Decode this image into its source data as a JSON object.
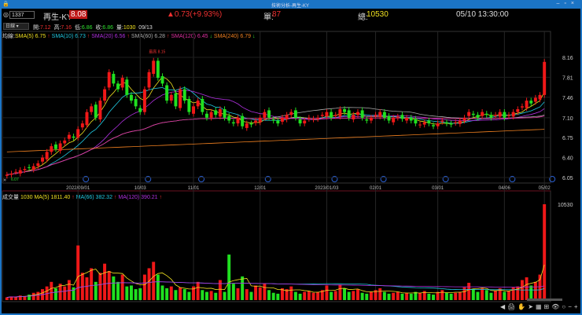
{
  "window": {
    "title": "技術分析-再生-KY"
  },
  "quote": {
    "code": "1337",
    "name": "再生-KY",
    "price": "8.08",
    "change": "▲0.73(+9.93%)",
    "unit_label": "單:",
    "unit": "87",
    "total_label": "總:",
    "total": "10530",
    "datetime": "05/10 13:30:00"
  },
  "ohlc": {
    "period": "日線",
    "open_label": "開:",
    "open": "7.12",
    "high_label": "高:",
    "high": "7.16",
    "low_label": "低:",
    "low": "6.86",
    "close_label": "收:",
    "close": "6.86",
    "vol_label": "量:",
    "vol": "1030",
    "date": "09/13"
  },
  "ma": {
    "label": "均線:",
    "items": [
      {
        "t": "SMA(5) 6.75",
        "c": "#f0e020",
        "a": "↑",
        "ac": "#f03030"
      },
      {
        "t": "SMA(10) 6.73",
        "c": "#20c8e0",
        "a": "↑",
        "ac": "#f03030"
      },
      {
        "t": "SMA(20) 6.56",
        "c": "#b030e0",
        "a": "↑",
        "ac": "#f03030"
      },
      {
        "t": "SMA(60) 6.28",
        "c": "#aaaaaa",
        "a": "↑",
        "ac": "#f03030"
      },
      {
        "t": "SMA(120) 6.45",
        "c": "#e030a0",
        "a": "↓",
        "ac": "#30e030"
      },
      {
        "t": "SMA(240) 6.79",
        "c": "#f08020",
        "a": "↓",
        "ac": "#30e030"
      }
    ]
  },
  "vol_ma": {
    "label": "成交量",
    "value": "1030",
    "items": [
      {
        "t": "MA(5) 1811.40",
        "c": "#f0e020"
      },
      {
        "t": "MA(66) 382.32",
        "c": "#20c8e0"
      },
      {
        "t": "MA(120) 390.21",
        "c": "#b030e0"
      }
    ],
    "arrow": "↑"
  },
  "annotations": {
    "high_mark": "最高 8.15",
    "low_mark": "6.07"
  },
  "chart_data": {
    "type": "candlestick",
    "price_ticks": [
      "8.16",
      "7.81",
      "7.46",
      "7.10",
      "6.75",
      "6.40",
      "6.05"
    ],
    "price_range": [
      6.05,
      8.16
    ],
    "volume_tick": "10530",
    "volume_max": 10530,
    "x_labels": [
      {
        "t": "2022/09/01",
        "i": 16
      },
      {
        "t": "10/03",
        "i": 30
      },
      {
        "t": "11/01",
        "i": 42
      },
      {
        "t": "12/01",
        "i": 57
      },
      {
        "t": "2023/01/03",
        "i": 72
      },
      {
        "t": "02/01",
        "i": 83
      },
      {
        "t": "03/01",
        "i": 97
      },
      {
        "t": "04/06",
        "i": 112
      },
      {
        "t": "05/02",
        "i": 121
      }
    ],
    "closes": [
      6.1,
      6.12,
      6.15,
      6.18,
      6.2,
      6.22,
      6.25,
      6.3,
      6.4,
      6.5,
      6.6,
      6.55,
      6.65,
      6.7,
      6.8,
      6.75,
      6.9,
      7.0,
      7.2,
      7.3,
      7.1,
      7.4,
      7.6,
      7.9,
      7.7,
      7.6,
      7.8,
      7.5,
      7.4,
      7.3,
      7.2,
      7.6,
      7.9,
      8.1,
      7.8,
      7.7,
      7.4,
      7.5,
      7.3,
      7.6,
      7.4,
      7.2,
      7.3,
      7.4,
      7.2,
      7.1,
      7.2,
      7.15,
      7.25,
      7.1,
      7.05,
      7.0,
      7.1,
      6.95,
      7.0,
      6.98,
      7.05,
      7.1,
      7.2,
      7.1,
      7.05,
      7.0,
      7.1,
      7.15,
      7.2,
      7.1,
      7.0,
      7.05,
      7.1,
      7.08,
      7.1,
      7.15,
      7.2,
      7.1,
      7.15,
      7.25,
      7.2,
      7.1,
      7.15,
      7.2,
      7.1,
      7.05,
      7.1,
      7.15,
      7.2,
      7.1,
      7.05,
      7.1,
      7.12,
      7.08,
      7.1,
      7.05,
      7.0,
      6.98,
      7.02,
      7.0,
      6.95,
      7.0,
      7.05,
      7.0,
      6.98,
      7.02,
      7.05,
      7.1,
      7.2,
      7.15,
      7.1,
      7.2,
      7.15,
      7.1,
      7.15,
      7.2,
      7.1,
      7.15,
      7.2,
      7.25,
      7.3,
      7.4,
      7.35,
      7.45,
      7.5,
      8.08
    ],
    "volumes": [
      300,
      400,
      350,
      500,
      450,
      600,
      800,
      900,
      1200,
      1500,
      2000,
      1300,
      1800,
      1500,
      2200,
      1400,
      6000,
      3000,
      2500,
      3500,
      2000,
      3000,
      4000,
      3200,
      2600,
      2000,
      2800,
      1500,
      1600,
      1200,
      1300,
      2800,
      3500,
      4200,
      2800,
      1600,
      1300,
      1500,
      1100,
      1400,
      1200,
      900,
      1500,
      2000,
      1100,
      900,
      1000,
      800,
      2200,
      900,
      5000,
      1800,
      1300,
      2600,
      1200,
      900,
      1600,
      1400,
      1800,
      1100,
      800,
      700,
      1300,
      1200,
      1500,
      900,
      700,
      900,
      1000,
      800,
      900,
      1100,
      1600,
      900,
      1000,
      1700,
      1300,
      900,
      1000,
      1200,
      800,
      700,
      900,
      1100,
      1300,
      900,
      700,
      800,
      900,
      700,
      800,
      700,
      900,
      800,
      1000,
      700,
      600,
      900,
      1100,
      800,
      700,
      800,
      900,
      1400,
      1900,
      1200,
      900,
      1300,
      1100,
      800,
      1000,
      1300,
      900,
      1000,
      1400,
      1500,
      2200,
      2500,
      1600,
      2000,
      2800,
      10530
    ]
  },
  "toolbar": [
    "◀",
    "🖨",
    "✋",
    "➤",
    "▦",
    "⊞",
    "👁",
    "○",
    "−",
    "+"
  ]
}
